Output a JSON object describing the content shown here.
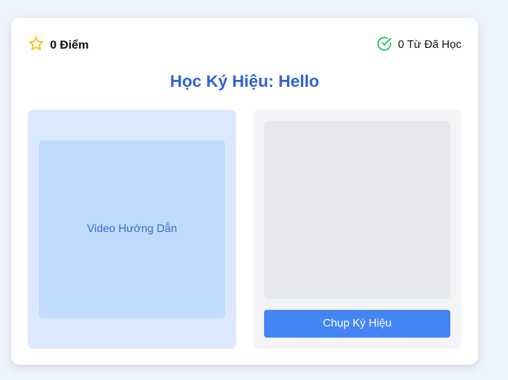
{
  "header": {
    "score_label": "0 Điểm",
    "score_icon": "star-icon",
    "learned_label": "0 Từ Đã Học",
    "learned_icon": "check-circle-icon"
  },
  "title": "Học Ký Hiệu: Hello",
  "video_panel": {
    "placeholder_text": "Video Hướng Dẫn"
  },
  "camera_panel": {
    "capture_button_label": "Chụp Ký Hiệu"
  },
  "colors": {
    "page_background": "#eef4fd",
    "title": "#2f62d9",
    "star": "#f5c518",
    "check": "#22c55e",
    "video_panel_bg": "#dbe9fe",
    "video_box_bg": "#bfdbfe",
    "camera_panel_bg": "#f3f4f6",
    "camera_box_bg": "#e5e7eb",
    "button_bg": "#4385f4"
  }
}
